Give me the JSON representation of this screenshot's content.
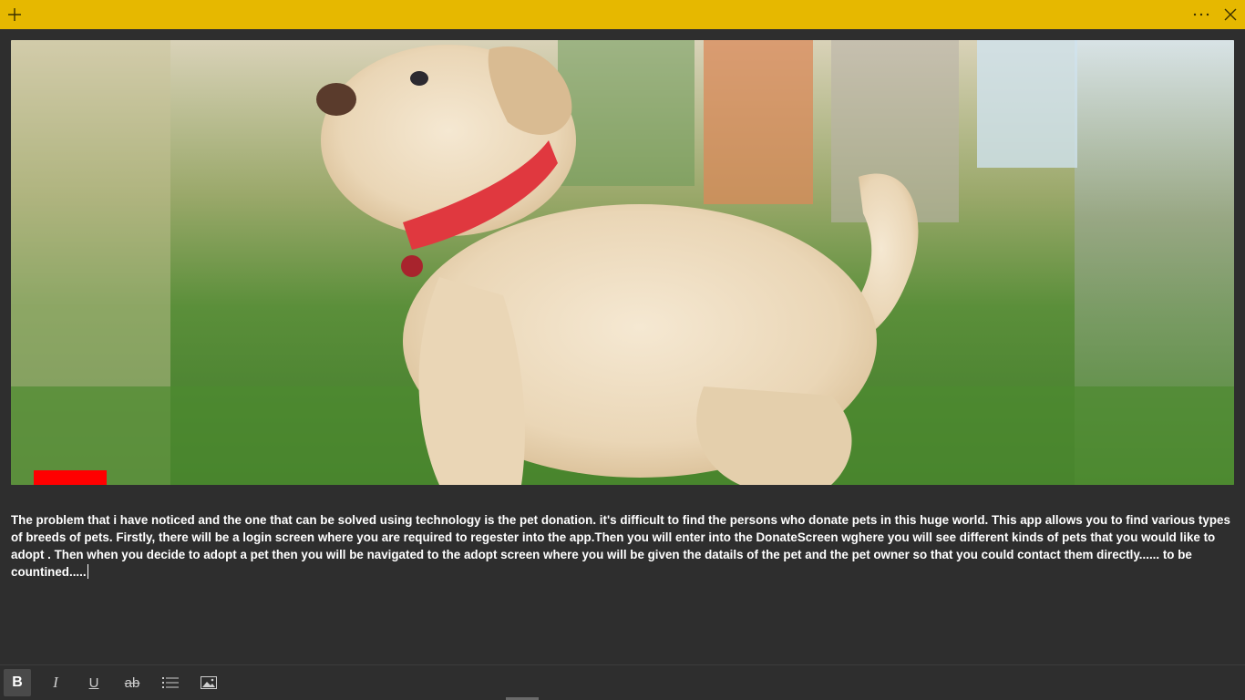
{
  "titlebar": {
    "color": "#e6b800",
    "add_icon": "plus-icon",
    "more_icon": "ellipsis-icon",
    "close_icon": "close-icon"
  },
  "note": {
    "image": {
      "subject": "puppy-photo",
      "accent_marker_color": "#ff0000"
    },
    "text": "The problem that i have noticed and the one that can be solved using technology is the pet donation. it's difficult to find the persons who donate pets in this huge world. This app allows you to find various types of breeds of pets. Firstly, there will be a login screen where you are required to regester into the app.Then you will enter into the DonateScreen wghere you will see different kinds of pets that you would like to adopt . Then when you decide to adopt a pet then you will be navigated to the adopt screen where you will be given the datails of the pet and the pet owner so that you could contact them directly...... to be countined....."
  },
  "toolbar": {
    "bold_label": "B",
    "italic_label": "I",
    "underline_label": "U",
    "strike_label": "ab",
    "list_icon": "bullet-list-icon",
    "image_icon": "insert-image-icon",
    "active": "bold"
  }
}
